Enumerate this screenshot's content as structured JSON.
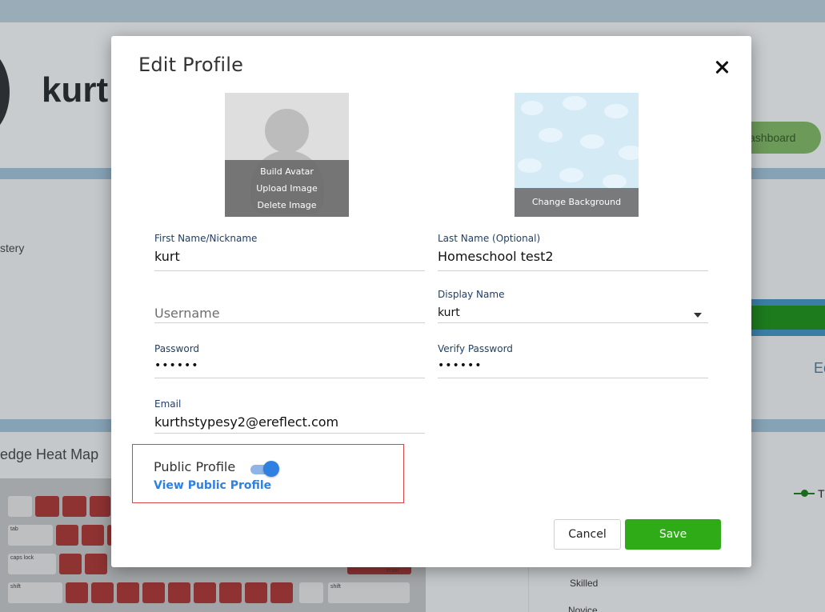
{
  "background": {
    "profile_name": "kurt",
    "dashboard_button": "ashboard",
    "mastery_label": "stery",
    "heat_map_title": "edge Heat Map",
    "edit_link": "Ed",
    "legend_label": "T",
    "chart_levels": [
      "Skilled",
      "Novice"
    ],
    "keyboard_keys": [
      "tab",
      "caps lock",
      "shift",
      "enter",
      "shift"
    ]
  },
  "modal": {
    "title": "Edit Profile",
    "avatar_actions": [
      "Build Avatar",
      "Upload Image",
      "Delete Image"
    ],
    "background_action": "Change Background",
    "fields": {
      "first_name": {
        "label": "First Name/Nickname",
        "value": "kurt"
      },
      "last_name": {
        "label": "Last Name (Optional)",
        "value": "Homeschool test2"
      },
      "username": {
        "placeholder": "Username"
      },
      "display_name": {
        "label": "Display Name",
        "value": "kurt"
      },
      "password": {
        "label": "Password",
        "value": "••••••"
      },
      "verify_password": {
        "label": "Verify Password",
        "value": "••••••"
      },
      "email": {
        "label": "Email",
        "value": "kurthstypesy2@ereflect.com"
      }
    },
    "public_profile": {
      "label": "Public Profile",
      "enabled": true,
      "link": "View Public Profile"
    },
    "buttons": {
      "cancel": "Cancel",
      "save": "Save"
    }
  },
  "colors": {
    "save": "#2eab17",
    "link": "#2f80e0",
    "highlight_border": "#d64545",
    "label": "#1f3f66"
  },
  "icons": [
    "close-icon",
    "avatar-placeholder-icon",
    "dropdown-arrow-icon",
    "toggle-switch"
  ]
}
